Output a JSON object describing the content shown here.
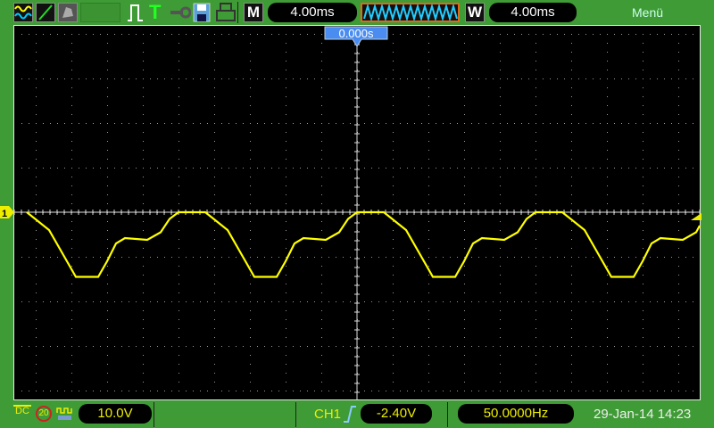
{
  "toolbar": {
    "icons": [
      "waveform-icon",
      "line-icon",
      "persistence-icon",
      "empty-slot",
      "pulse-icon",
      "trigger-icon",
      "key-icon",
      "save-icon",
      "print-icon"
    ],
    "trigger_T": "T",
    "main_label": "M",
    "main_timebase": "4.00ms",
    "window_label": "W",
    "window_timebase": "4.00ms",
    "menu": "Menü"
  },
  "display": {
    "trigger_position": "0.000s",
    "channel_marker": "1",
    "trace_color": "#ffff00",
    "period_ms": 20,
    "trace_period_points_ms_v": [
      [
        -1.5,
        0
      ],
      [
        1.5,
        0
      ],
      [
        4,
        -4
      ],
      [
        6,
        -11
      ],
      [
        7,
        -14.5
      ],
      [
        9.5,
        -14.5
      ],
      [
        10.5,
        -11
      ],
      [
        11.5,
        -7
      ],
      [
        12.5,
        -5.8
      ],
      [
        15,
        -6.2
      ],
      [
        16.5,
        -4.5
      ],
      [
        17.5,
        -1.5
      ],
      [
        18.5,
        0
      ]
    ],
    "peak_offset_ms": 1.5
  },
  "status": {
    "coupling": "DC",
    "bw_limit": "20",
    "volts_div": "10.0V",
    "channel": "CH1",
    "trigger_level": "-2.40V",
    "frequency": "50.0000Hz",
    "datetime": "29-Jan-14 14:23"
  }
}
